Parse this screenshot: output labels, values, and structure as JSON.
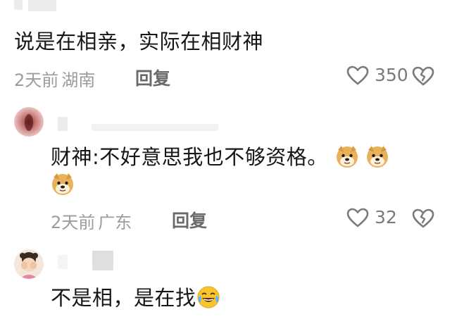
{
  "comments": [
    {
      "text": "说是在相亲，实际在相财神",
      "time": "2天前",
      "location": "湖南",
      "reply_label": "回复",
      "likes": "350"
    },
    {
      "text_line1": "财神:不好意思我也不够资格。",
      "time": "2天前",
      "location": "广东",
      "reply_label": "回复",
      "likes": "32",
      "emojis": [
        "doge-emoji",
        "doge-emoji",
        "doge-emoji"
      ]
    },
    {
      "text": "不是相，是在找",
      "emojis": [
        "laugh-cry-emoji"
      ]
    }
  ],
  "icons": {
    "like": "heart-outline-icon",
    "dislike": "broken-heart-icon"
  },
  "colors": {
    "text": "#161616",
    "meta": "#9c9c9c",
    "reply": "#6a6a6a",
    "icon": "#7a7a7a",
    "background": "#ffffff"
  }
}
